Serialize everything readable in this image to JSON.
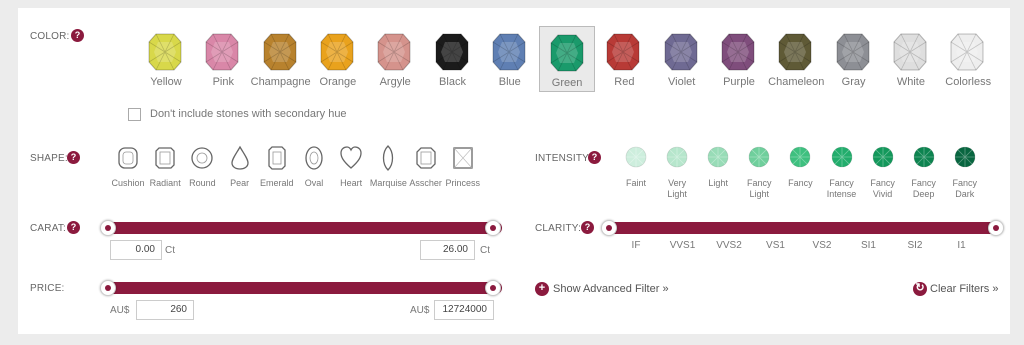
{
  "color": {
    "label": "COLOR:",
    "help": "?",
    "stones": [
      {
        "name": "Yellow",
        "fill": "#d8d84a"
      },
      {
        "name": "Pink",
        "fill": "#d987a8"
      },
      {
        "name": "Champagne",
        "fill": "#b8822e"
      },
      {
        "name": "Orange",
        "fill": "#e9a21d"
      },
      {
        "name": "Argyle",
        "fill": "#d5938c"
      },
      {
        "name": "Black",
        "fill": "#1b1b1b"
      },
      {
        "name": "Blue",
        "fill": "#5f7fb3"
      },
      {
        "name": "Green",
        "fill": "#1a9a6b",
        "selected": true
      },
      {
        "name": "Red",
        "fill": "#b83a36"
      },
      {
        "name": "Violet",
        "fill": "#6f6a93"
      },
      {
        "name": "Purple",
        "fill": "#7f4d7c"
      },
      {
        "name": "Chameleon",
        "fill": "#5f5a36"
      },
      {
        "name": "Gray",
        "fill": "#8d8f95"
      },
      {
        "name": "White",
        "fill": "#dedede"
      },
      {
        "name": "Colorless",
        "fill": "#eeeeee"
      }
    ],
    "secondary_hue_label": "Don't include stones with secondary hue"
  },
  "shape": {
    "label": "SHAPE:",
    "help": "?",
    "items": [
      {
        "name": "Cushion",
        "icon": "cushion-icon"
      },
      {
        "name": "Radiant",
        "icon": "radiant-icon"
      },
      {
        "name": "Round",
        "icon": "round-icon"
      },
      {
        "name": "Pear",
        "icon": "pear-icon"
      },
      {
        "name": "Emerald",
        "icon": "emerald-icon"
      },
      {
        "name": "Oval",
        "icon": "oval-icon"
      },
      {
        "name": "Heart",
        "icon": "heart-icon"
      },
      {
        "name": "Marquise",
        "icon": "marquise-icon"
      },
      {
        "name": "Asscher",
        "icon": "asscher-icon"
      },
      {
        "name": "Princess",
        "icon": "princess-icon"
      }
    ]
  },
  "intensity": {
    "label": "INTENSITY:",
    "help": "?",
    "items": [
      {
        "lines": [
          "Faint",
          ""
        ],
        "fill": "#cdeedd"
      },
      {
        "lines": [
          "Very",
          "Light"
        ],
        "fill": "#b6e6cc"
      },
      {
        "lines": [
          "Light",
          ""
        ],
        "fill": "#98dcb7"
      },
      {
        "lines": [
          "Fancy",
          "Light"
        ],
        "fill": "#6fcf9c"
      },
      {
        "lines": [
          "Fancy",
          ""
        ],
        "fill": "#3ec07f"
      },
      {
        "lines": [
          "Fancy",
          "Intense"
        ],
        "fill": "#22ad6c"
      },
      {
        "lines": [
          "Fancy",
          "Vivid"
        ],
        "fill": "#13985b"
      },
      {
        "lines": [
          "Fancy",
          "Deep"
        ],
        "fill": "#0d8450"
      },
      {
        "lines": [
          "Fancy",
          "Dark"
        ],
        "fill": "#086640"
      }
    ]
  },
  "carat": {
    "label": "CARAT:",
    "help": "?",
    "min": "0.00",
    "max": "26.00",
    "unit": "Ct"
  },
  "clarity": {
    "label": "CLARITY:",
    "help": "?",
    "ticks": [
      "IF",
      "VVS1",
      "VVS2",
      "VS1",
      "VS2",
      "SI1",
      "SI2",
      "I1"
    ]
  },
  "price": {
    "label": "PRICE:",
    "currency": "AU$",
    "min": "260",
    "max": "12724000"
  },
  "advanced_filter": {
    "label": "Show Advanced Filter »",
    "icon": "+"
  },
  "clear_filters": {
    "label": "Clear Filters »",
    "icon": "↻"
  },
  "colors": {
    "accent": "#8b1a3e"
  }
}
